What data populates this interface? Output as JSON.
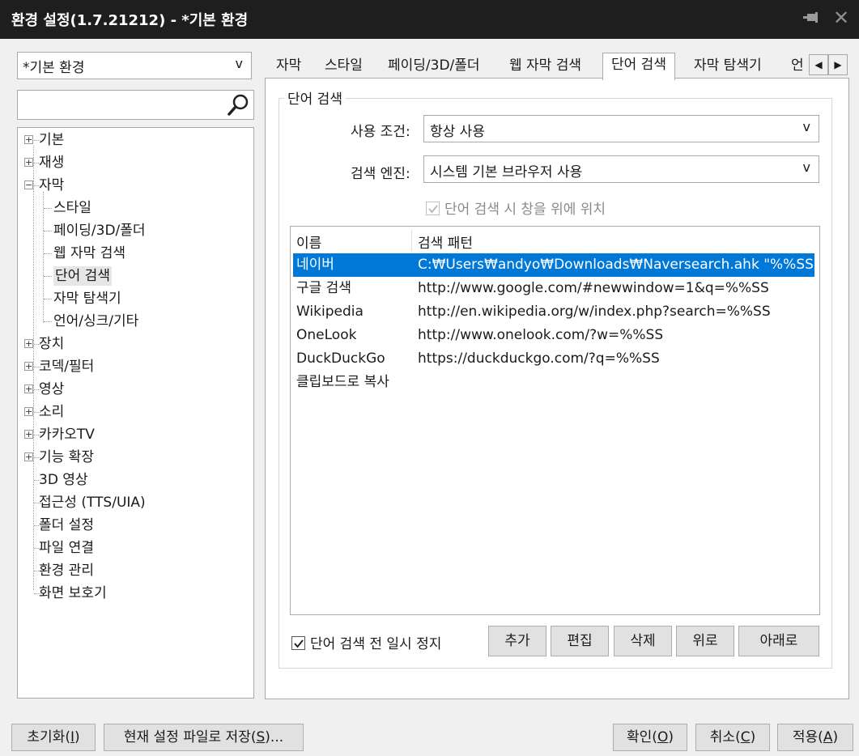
{
  "window": {
    "title": "환경 설정(1.7.21212) - *기본 환경",
    "pin_icon": "pin-icon",
    "close_icon": "close-icon"
  },
  "profile_select": {
    "value": "*기본 환경",
    "chevron": "v"
  },
  "tree_search": {
    "value": "",
    "icon": "search-icon"
  },
  "tree": {
    "items": [
      {
        "label": "기본",
        "expander": "+"
      },
      {
        "label": "재생",
        "expander": "+"
      },
      {
        "label": "자막",
        "expander": "−"
      },
      {
        "label": "스타일"
      },
      {
        "label": "페이딩/3D/폴더"
      },
      {
        "label": "웹 자막 검색"
      },
      {
        "label": "단어 검색",
        "selected": true
      },
      {
        "label": "자막 탐색기"
      },
      {
        "label": "언어/싱크/기타"
      },
      {
        "label": "장치",
        "expander": "+"
      },
      {
        "label": "코덱/필터",
        "expander": "+"
      },
      {
        "label": "영상",
        "expander": "+"
      },
      {
        "label": "소리",
        "expander": "+"
      },
      {
        "label": "카카오TV",
        "expander": "+"
      },
      {
        "label": "기능 확장",
        "expander": "+"
      },
      {
        "label": "3D 영상"
      },
      {
        "label": "접근성 (TTS/UIA)"
      },
      {
        "label": "폴더 설정"
      },
      {
        "label": "파일 연결"
      },
      {
        "label": "환경 관리"
      },
      {
        "label": "화면 보호기"
      }
    ]
  },
  "tabs": {
    "items": [
      "자막",
      "스타일",
      "페이딩/3D/폴더",
      "웹 자막 검색",
      "단어 검색",
      "자막 탐색기",
      "언"
    ],
    "active": "단어 검색",
    "scroll_left": "◀",
    "scroll_right": "▶"
  },
  "word_search": {
    "group_title": "단어 검색",
    "condition_label": "사용 조건:",
    "condition_value": "항상 사용",
    "engine_label": "검색 엔진:",
    "engine_value": "시스템 기본 브라우저 사용",
    "on_top_label": "단어 검색 시 창을 위에 위치",
    "on_top_checked": true,
    "on_top_disabled": true,
    "list_headers": [
      "이름",
      "검색 패턴"
    ],
    "list_rows": [
      {
        "name": "네이버",
        "pattern": "C:₩Users₩andyo₩Downloads₩Naversearch.ahk \"%%SS\"",
        "selected": true
      },
      {
        "name": "구글 검색",
        "pattern": "http://www.google.com/#newwindow=1&q=%%SS"
      },
      {
        "name": "Wikipedia",
        "pattern": "http://en.wikipedia.org/w/index.php?search=%%SS"
      },
      {
        "name": "OneLook",
        "pattern": "http://www.onelook.com/?w=%%SS"
      },
      {
        "name": "DuckDuckGo",
        "pattern": "https://duckduckgo.com/?q=%%SS"
      },
      {
        "name": "클립보드로 복사",
        "pattern": ""
      }
    ],
    "pause_label": "단어 검색 전 일시 정지",
    "pause_checked": true,
    "buttons": {
      "add": "추가",
      "edit": "편집",
      "delete": "삭제",
      "up": "위로",
      "down": "아래로"
    }
  },
  "footer": {
    "reset_label": "초기화",
    "reset_key": "I",
    "save_file_label": "현재 설정 파일로 저장",
    "save_file_key": "S",
    "save_file_suffix": "...",
    "ok_label": "확인",
    "ok_key": "O",
    "cancel_label": "취소",
    "cancel_key": "C",
    "apply_label": "적용",
    "apply_key": "A"
  },
  "colors": {
    "titlebar": "#1e1e1e",
    "selection": "#0078d7",
    "window_bg": "#f0f0f0"
  }
}
